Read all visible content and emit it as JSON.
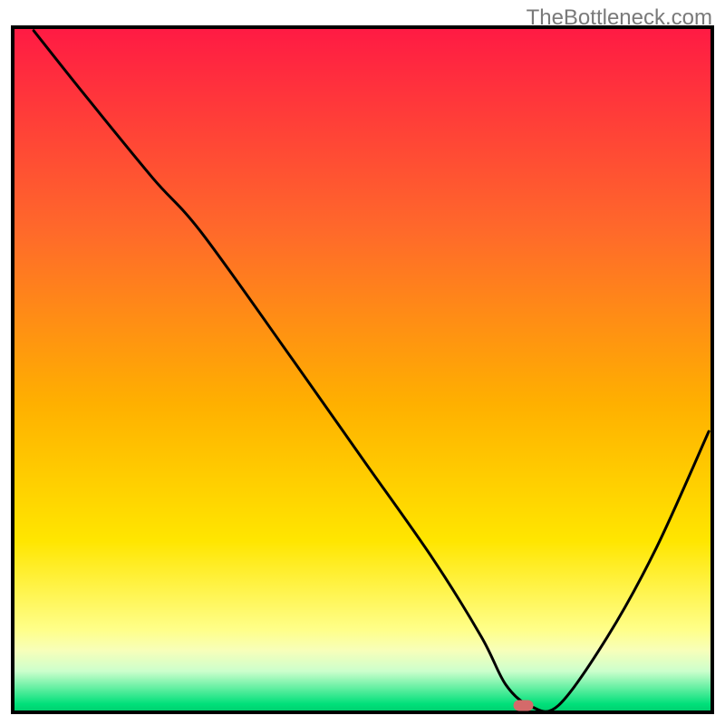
{
  "watermark": "TheBottleneck.com",
  "chart_data": {
    "type": "line",
    "title": "",
    "xlabel": "",
    "ylabel": "",
    "xlim": [
      0,
      100
    ],
    "ylim": [
      0,
      100
    ],
    "series": [
      {
        "name": "curve",
        "x": [
          3.0,
          10.0,
          20.0,
          27.0,
          40.0,
          50.0,
          60.0,
          67.0,
          70.5,
          74.0,
          78.0,
          85.0,
          92.0,
          99.5
        ],
        "y": [
          99.5,
          90.5,
          78.0,
          70.0,
          51.5,
          37.0,
          22.5,
          11.0,
          4.0,
          0.9,
          1.0,
          11.0,
          24.0,
          41.0
        ]
      }
    ],
    "marker": {
      "x": 73.0,
      "y": 1.0,
      "color": "#d46a6a"
    },
    "gradient_bands": [
      {
        "y0": 100,
        "y1": 20,
        "from": "#ff1a44",
        "to": "#ffd200"
      },
      {
        "y0": 20,
        "y1": 9,
        "from": "#ffd200",
        "to": "#ffff66"
      },
      {
        "y0": 9,
        "y1": 0.2,
        "from": "#ffff66",
        "to": "#00e07a"
      }
    ],
    "frame": {
      "color": "#000000",
      "width": 4
    }
  }
}
